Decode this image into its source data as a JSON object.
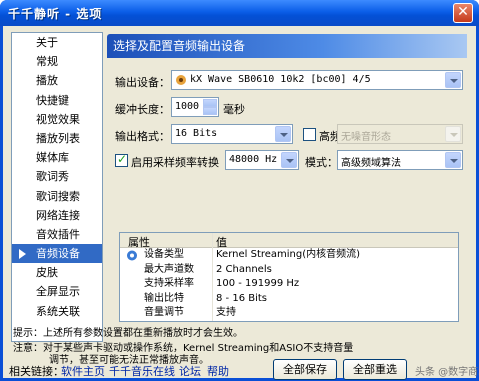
{
  "window": {
    "title": "千千静听 - 选项",
    "close_label": "✕"
  },
  "sidebar": {
    "items": [
      {
        "label": "关于"
      },
      {
        "label": "常规"
      },
      {
        "label": "播放"
      },
      {
        "label": "快捷键"
      },
      {
        "label": "视觉效果"
      },
      {
        "label": "播放列表"
      },
      {
        "label": "媒体库"
      },
      {
        "label": "歌词秀"
      },
      {
        "label": "歌词搜索"
      },
      {
        "label": "网络连接"
      },
      {
        "label": "音效插件"
      },
      {
        "label": "音频设备",
        "active": true
      },
      {
        "label": "皮肤"
      },
      {
        "label": "全屏显示"
      },
      {
        "label": "系统关联"
      }
    ]
  },
  "panel": {
    "header": "选择及配置音频输出设备",
    "output_device_label": "输出设备：",
    "output_device_value": "kX Wave SB0610 10k2 [bc00] 4/5",
    "buffer_label": "缓冲长度：",
    "buffer_value": "1000",
    "buffer_unit": "毫秒",
    "format_label": "输出格式：",
    "format_value": "16 Bits",
    "dither_label": "高频抖动",
    "dither_checked": false,
    "dither_value": "无噪音形态",
    "resample_label": "启用采样频率转换",
    "resample_checked": true,
    "resample_value": "48000 Hz",
    "mode_label": "模式：",
    "mode_value": "高级频域算法"
  },
  "properties": {
    "col_property": "属性",
    "col_value": "值",
    "rows": [
      {
        "key": "设备类型",
        "value": "Kernel Streaming(内核音频流)"
      },
      {
        "key": "最大声道数",
        "value": "2 Channels"
      },
      {
        "key": "支持采样率",
        "value": "100 - 191999 Hz"
      },
      {
        "key": "输出比特",
        "value": "8 - 16 Bits"
      },
      {
        "key": "音量调节",
        "value": "支持"
      }
    ]
  },
  "hints": {
    "line1": "提示：上述所有参数设置都在重新播放时才会生效。",
    "line2": "注意：对于某些声卡驱动或操作系统，Kernel Streaming和ASIO不支持音量",
    "line3": "调节，甚至可能无法正常播放声音。"
  },
  "footer": {
    "links_label": "相关链接：",
    "link1": "软件主页",
    "link2": "千千音乐在线",
    "link3": "论坛",
    "link4": "帮助",
    "save_all": "全部保存",
    "reset_all": "全部重选",
    "watermark": "头条 @数字商城"
  },
  "colors": {
    "accent": "#316ac5",
    "titlebar": "#0b5ee8",
    "face": "#ece9d8"
  }
}
